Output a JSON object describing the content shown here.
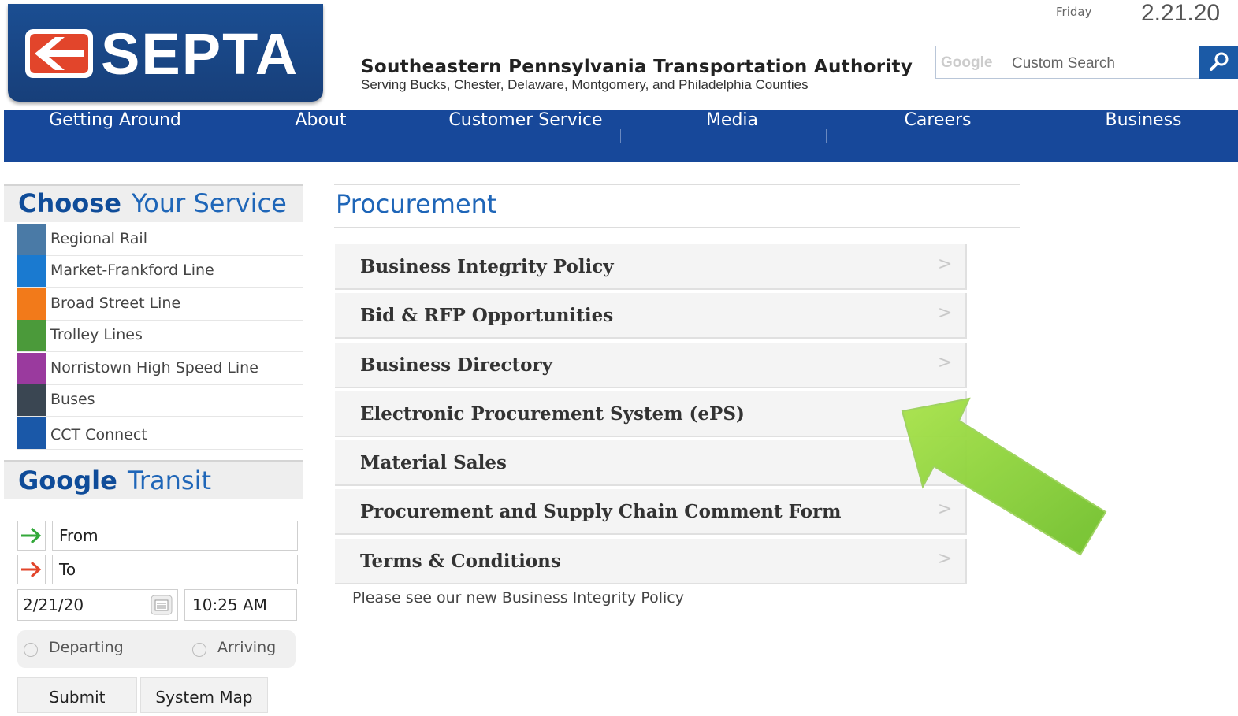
{
  "header": {
    "logo_text": "SEPTA",
    "org_name": "Southeastern Pennsylvania Transportation Authority",
    "org_sub": "Serving Bucks, Chester, Delaware, Montgomery, and Philadelphia Counties",
    "day": "Friday",
    "date": "2.21.20",
    "search_brand": "Google",
    "search_placeholder": "Custom Search"
  },
  "nav": [
    "Getting Around",
    "About",
    "Customer Service",
    "Media",
    "Careers",
    "Business"
  ],
  "sidebar": {
    "choose_title_a": "Choose",
    "choose_title_b": "Your Service",
    "services": [
      {
        "label": "Regional Rail",
        "color": "#4a7aa6"
      },
      {
        "label": "Market-Frankford Line",
        "color": "#1a7ad0"
      },
      {
        "label": "Broad Street Line",
        "color": "#f27a1a"
      },
      {
        "label": "Trolley Lines",
        "color": "#4b9a3a"
      },
      {
        "label": "Norristown High Speed Line",
        "color": "#9a3a9e"
      },
      {
        "label": "Buses",
        "color": "#3a4652"
      },
      {
        "label": "CCT Connect",
        "color": "#1a58a8"
      }
    ],
    "transit_title_a": "Google",
    "transit_title_b": "Transit",
    "from": "From",
    "to": "To",
    "date_value": "2/21/20",
    "time_value": "10:25 AM",
    "departing": "Departing",
    "arriving": "Arriving",
    "submit": "Submit",
    "system_map": "System Map"
  },
  "main": {
    "title": "Procurement",
    "items": [
      "Business Integrity Policy",
      "Bid & RFP Opportunities",
      "Business Directory",
      "Electronic Procurement System (ePS)",
      "Material Sales",
      "Procurement and Supply Chain Comment Form",
      "Terms & Conditions"
    ],
    "chevron": ">",
    "note": "Please see our new Business Integrity Policy"
  },
  "colors": {
    "nav": "#17489a",
    "accent": "#1f66b8",
    "annotation_arrow": "#8cd13a"
  }
}
